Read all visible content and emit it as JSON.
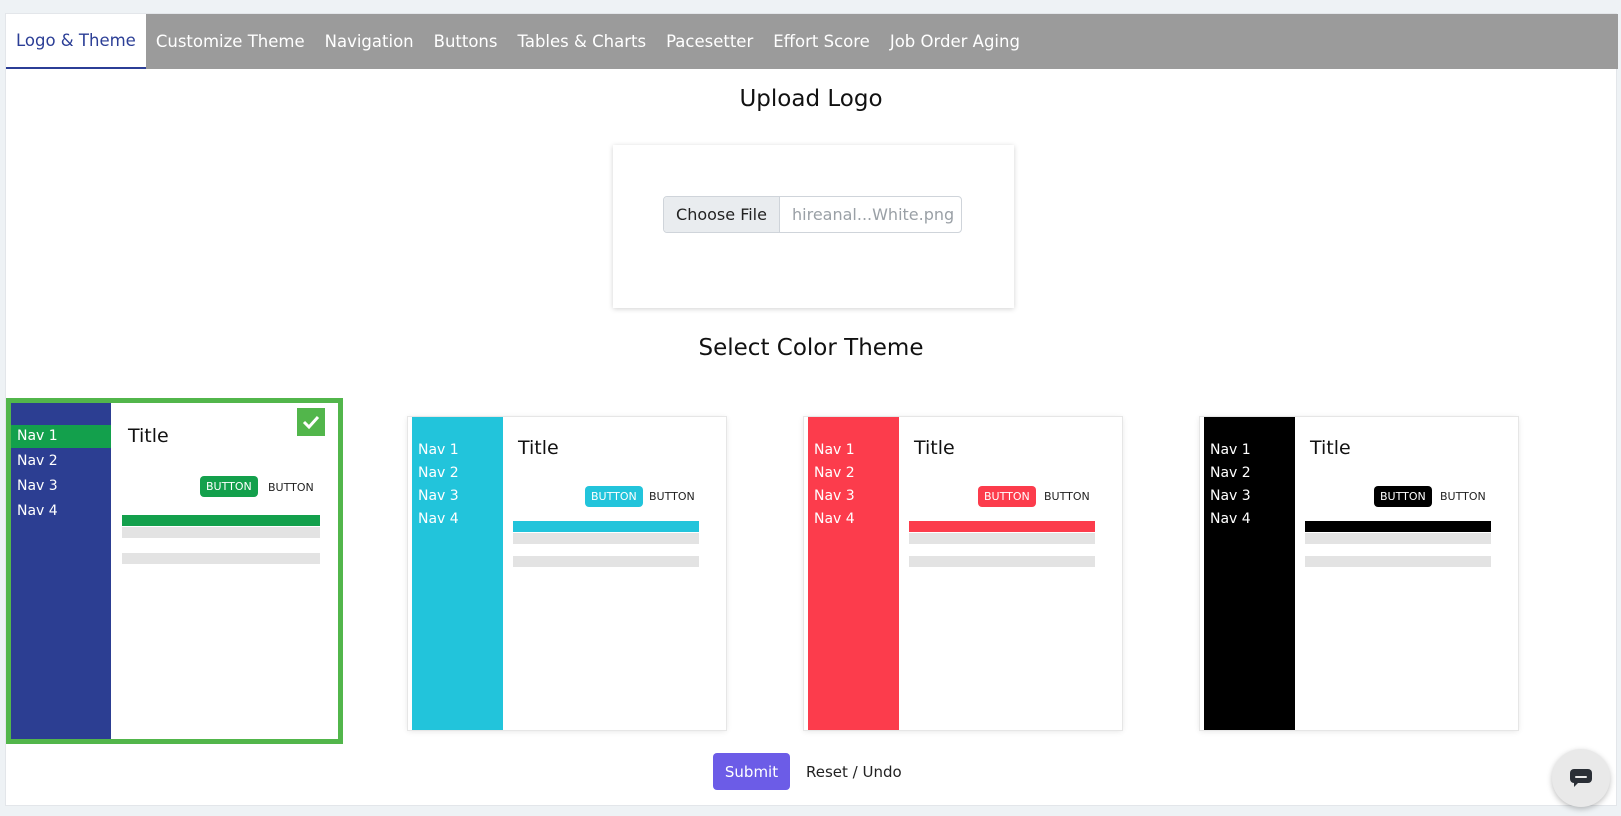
{
  "tabs": [
    {
      "label": "Logo & Theme"
    },
    {
      "label": "Customize Theme"
    },
    {
      "label": "Navigation"
    },
    {
      "label": "Buttons"
    },
    {
      "label": "Tables & Charts"
    },
    {
      "label": "Pacesetter"
    },
    {
      "label": "Effort Score"
    },
    {
      "label": "Job Order Aging"
    }
  ],
  "upload": {
    "heading": "Upload Logo",
    "choose_file": "Choose File",
    "file_name": "hireanal...White.png"
  },
  "themes": {
    "heading": "Select Color Theme",
    "preview_title": "Title",
    "nav_items": [
      "Nav 1",
      "Nav 2",
      "Nav 3",
      "Nav 4"
    ],
    "primary_button": "BUTTON",
    "secondary_button": "BUTTON",
    "options": [
      {
        "sidebar_color": "#2c3e92",
        "accent_color": "#13a04c",
        "selected": true
      },
      {
        "sidebar_color": "#22c4db",
        "accent_color": "#22c4db",
        "selected": false
      },
      {
        "sidebar_color": "#fc3c4c",
        "accent_color": "#fc3c4c",
        "selected": false
      },
      {
        "sidebar_color": "#000000",
        "accent_color": "#000000",
        "selected": false
      }
    ]
  },
  "actions": {
    "submit": "Submit",
    "reset": "Reset / Undo"
  },
  "icons": {
    "selected_check": "check-icon",
    "chat": "chat-icon"
  },
  "colors": {
    "active_tab": "#2b3e96",
    "tabbar": "#9b9b9b",
    "submit": "#6c5ce7",
    "selected_border": "#52b64b"
  }
}
